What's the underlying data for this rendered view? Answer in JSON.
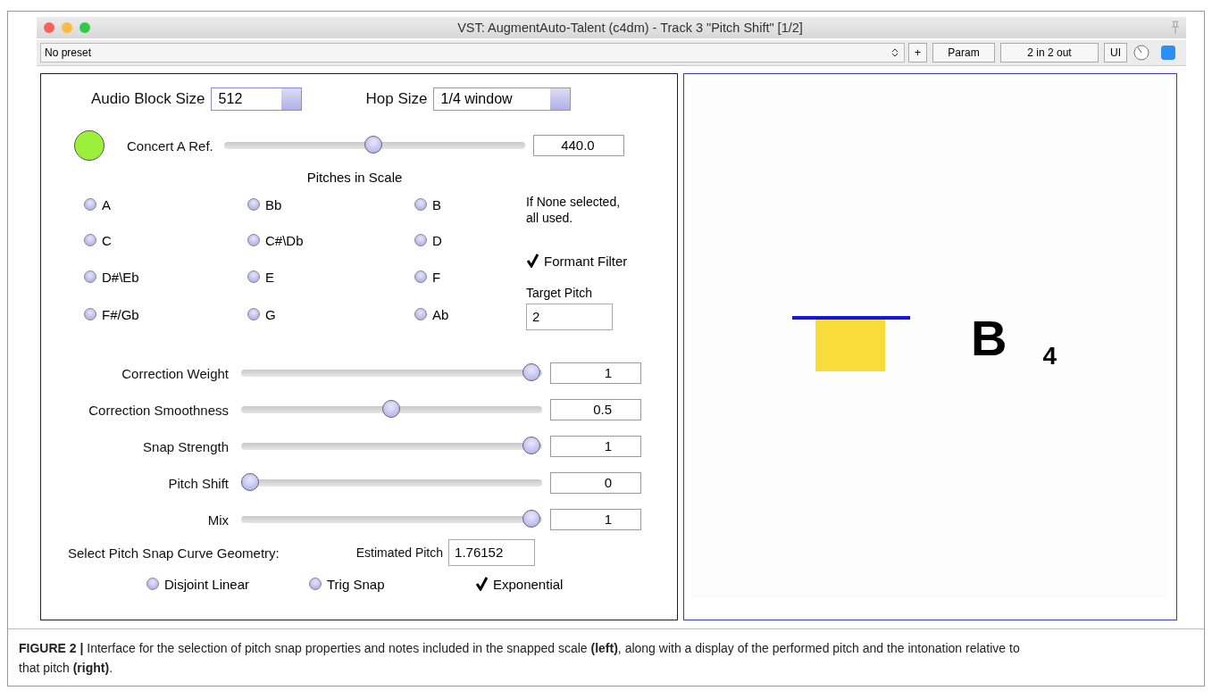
{
  "window": {
    "title": "VST: AugmentAuto-Talent (c4dm) - Track 3 \"Pitch Shift\" [1/2]"
  },
  "toolbar": {
    "preset": "No preset",
    "add": "+",
    "param": "Param",
    "io": "2 in 2 out",
    "ui": "UI",
    "enabled": true
  },
  "audio_block_size": {
    "label": "Audio Block Size",
    "value": "512"
  },
  "hop_size": {
    "label": "Hop Size",
    "value": "1/4 window"
  },
  "indicator": {
    "on": true
  },
  "concert_a": {
    "label": "Concert A Ref.",
    "level": 0.5,
    "value": "440.0"
  },
  "pitches_heading": "Pitches in Scale",
  "pitches": [
    {
      "label": "A",
      "selected": false
    },
    {
      "label": "Bb",
      "selected": false
    },
    {
      "label": "B",
      "selected": false
    },
    {
      "label": "C",
      "selected": false
    },
    {
      "label": "C#\\Db",
      "selected": false
    },
    {
      "label": "D",
      "selected": false
    },
    {
      "label": "D#\\Eb",
      "selected": false
    },
    {
      "label": "E",
      "selected": false
    },
    {
      "label": "F",
      "selected": false
    },
    {
      "label": "F#/Gb",
      "selected": false
    },
    {
      "label": "G",
      "selected": false
    },
    {
      "label": "Ab",
      "selected": false
    }
  ],
  "note": "If None selected, all used.",
  "formant_filter": {
    "label": "Formant Filter",
    "checked": true
  },
  "target_pitch": {
    "label": "Target Pitch",
    "value": "2"
  },
  "sliders": [
    {
      "label": "Correction Weight",
      "level": 1,
      "value": "1"
    },
    {
      "label": "Correction Smoothness",
      "level": 0.5,
      "value": "0.5"
    },
    {
      "label": "Snap Strength",
      "level": 1,
      "value": "1"
    },
    {
      "label": "Pitch Shift",
      "level": 0,
      "value": "0"
    },
    {
      "label": "Mix",
      "level": 1,
      "value": "1"
    }
  ],
  "geometry_heading": "Select Pitch Snap Curve Geometry:",
  "estimated_pitch": {
    "label": "Estimated Pitch",
    "value": "1.76152"
  },
  "geometry": [
    {
      "label": "Disjoint Linear",
      "selected": false
    },
    {
      "label": "Trig Snap",
      "selected": false
    },
    {
      "label": "Exponential",
      "selected": true
    }
  ],
  "display": {
    "note": "B",
    "octave": "4"
  },
  "caption": "**FIGURE 2 |** Interface for the selection of pitch snap properties and notes included in the snapped scale **(left)**, along with a display of the performed pitch and the intonation relative to that pitch **(right)**."
}
